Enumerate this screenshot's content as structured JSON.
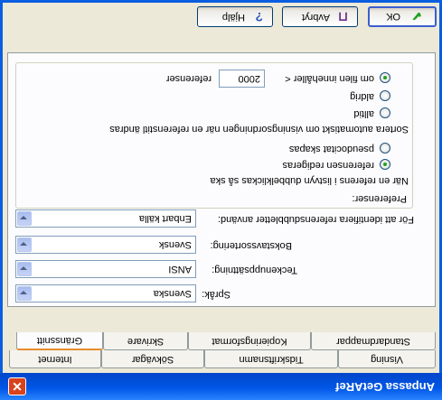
{
  "window": {
    "title": "Anpassa GetARef",
    "close_glyph": "✕"
  },
  "tabs": {
    "row_back": [
      "Visning",
      "Tidskriftsnamn",
      "Sökvägar",
      "Internet"
    ],
    "row_front": [
      "Standardmappar",
      "Kopieringsformat",
      "Skrivare",
      "Gränssnitt"
    ],
    "active": "Gränssnitt"
  },
  "fields": {
    "language_label": "Språk:",
    "language_value": "Svenska",
    "charset_label": "Teckenuppsättning:",
    "charset_value": "ANSI",
    "sort_label": "Bokstavssortering:",
    "sort_value": "Svensk",
    "dup_label": "För att identifiera referensdubbletter använd:",
    "dup_value": "Enbart källa"
  },
  "preferences": {
    "group_label": "Preferenser:",
    "doubleclick_question": "När en referens i listvyn dubbelklickas så ska",
    "opt_edit": "referensen redigeras",
    "opt_pseudocite": "pseudocitat skapas",
    "sort_question": "Sortera automatiskt om visningsordningen när en referenstitl ändras",
    "opt_always": "alltid",
    "opt_never": "aldrig",
    "opt_ifmore": "om filen innehåller <",
    "threshold": "2000",
    "threshold_suffix": "referenser"
  },
  "buttons": {
    "ok": "OK",
    "cancel": "Avbryt",
    "help": "Hjälp"
  },
  "icons": {
    "help": "help-icon",
    "cancel": "cancel-icon",
    "ok": "checkmark-icon",
    "close": "close-icon",
    "dropdown": "chevron-down-icon"
  },
  "colors": {
    "titlebar": "#0055e5",
    "client": "#ece9d8",
    "active_tab_accent": "#e68b2c",
    "close_button": "#d9421c",
    "ok_check": "#21a121"
  }
}
